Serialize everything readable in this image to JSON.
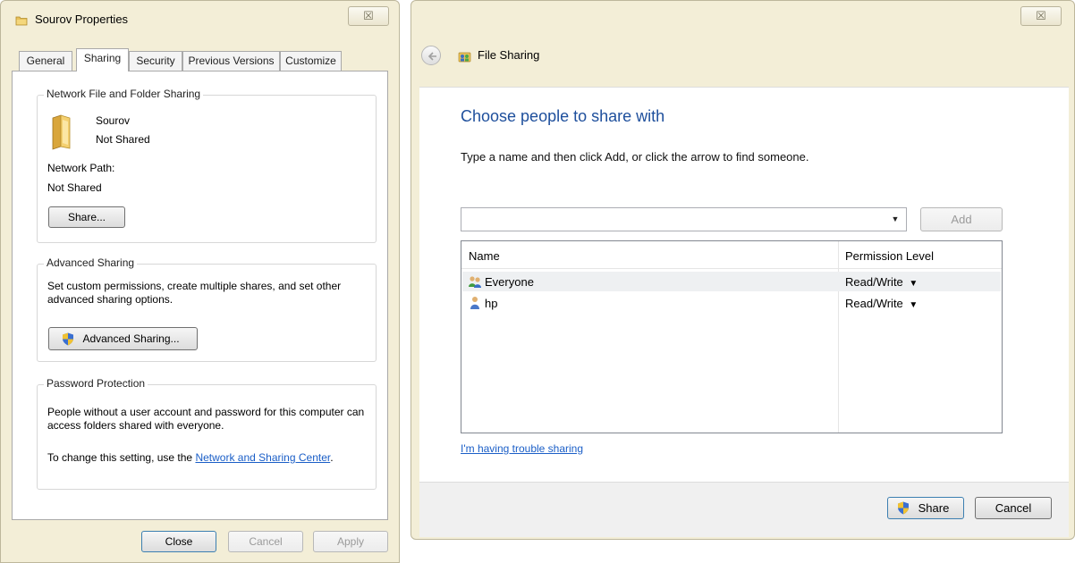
{
  "props": {
    "title": "Sourov Properties",
    "close_glyph": "☒",
    "tabs": [
      "General",
      "Sharing",
      "Security",
      "Previous Versions",
      "Customize"
    ],
    "active_tab": "Sharing",
    "network_sharing": {
      "group_title": "Network File and Folder Sharing",
      "folder_name": "Sourov",
      "folder_status": "Not Shared",
      "path_label": "Network Path:",
      "path_value": "Not Shared",
      "share_button": "Share..."
    },
    "advanced_sharing": {
      "group_title": "Advanced Sharing",
      "description": "Set custom permissions, create multiple shares, and set other advanced sharing options.",
      "button": "Advanced Sharing..."
    },
    "password_protection": {
      "group_title": "Password Protection",
      "description": "People without a user account and password for this computer can access folders shared with everyone.",
      "change_prefix": "To change this setting, use the ",
      "link": "Network and Sharing Center",
      "change_suffix": "."
    },
    "buttons": {
      "close": "Close",
      "cancel": "Cancel",
      "apply": "Apply"
    }
  },
  "share_dialog": {
    "title": "File Sharing",
    "close_glyph": "☒",
    "heading": "Choose people to share with",
    "instructions": "Type a name and then click Add, or click the arrow to find someone.",
    "name_input_value": "",
    "add_button": "Add",
    "columns": [
      "Name",
      "Permission Level"
    ],
    "rows": [
      {
        "name": "Everyone",
        "permission": "Read/Write",
        "icon": "group-users-icon"
      },
      {
        "name": "hp",
        "permission": "Read/Write",
        "icon": "user-icon"
      }
    ],
    "trouble_link": "I'm having trouble sharing",
    "share_button": "Share",
    "cancel_button": "Cancel"
  },
  "colors": {
    "window_frame": "#f3eed7",
    "heading_blue": "#1e4f9c",
    "link_blue": "#1a5ec7",
    "selected_row": "#eef0f2"
  }
}
